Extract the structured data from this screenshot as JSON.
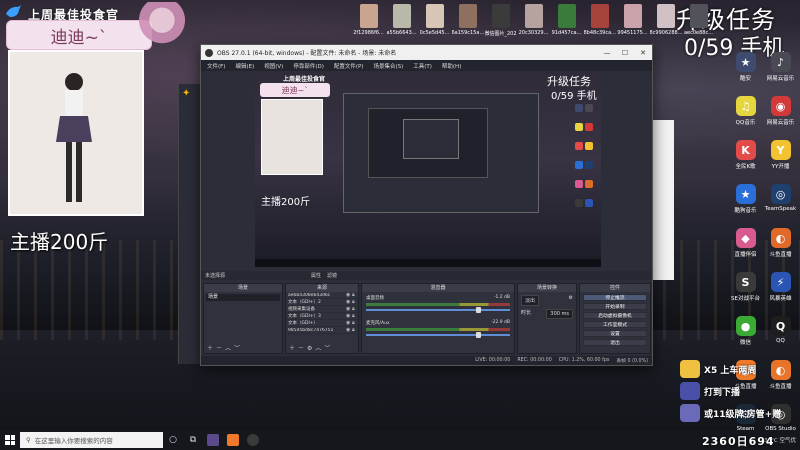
{
  "overlay": {
    "room_title": "上周最佳投食官",
    "streamer_name": "迪迪~`",
    "weight_text": "主播200斤",
    "upgrade_title": "升级任务",
    "upgrade_progress": "0/59 手机"
  },
  "desktop_icons_top": [
    {
      "label": "2f12986f6...",
      "color": "#c9a58f"
    },
    {
      "label": "a55b6643...",
      "color": "#b9b9a9"
    },
    {
      "label": "0c5e5d45...",
      "color": "#d7c6b6"
    },
    {
      "label": "6a159c15a...",
      "color": "#8f6f5e"
    },
    {
      "label": "微信图片_20210708...",
      "color": "#3b3b3b"
    },
    {
      "label": "20c30329...",
      "color": "#b6a39f"
    },
    {
      "label": "91d457ca...",
      "color": "#3a7a3a"
    },
    {
      "label": "8b48c39ca...",
      "color": "#a6433c"
    },
    {
      "label": "99451175...",
      "color": "#c9a3a9"
    },
    {
      "label": "8c9906288...",
      "color": "#d1c1c5"
    },
    {
      "label": "aec0e88c...",
      "color": "#52525b"
    }
  ],
  "desktop_icons_right": [
    {
      "label": "酷安",
      "glyph": "★",
      "color": "#3e4a6e"
    },
    {
      "label": "网易云音乐",
      "glyph": "♪",
      "color": "#4a4a55"
    },
    {
      "label": "QQ音乐",
      "glyph": "♫",
      "color": "#e5d640"
    },
    {
      "label": "网易云音乐",
      "glyph": "◉",
      "color": "#d23a3a"
    },
    {
      "label": "全民K歌",
      "glyph": "K",
      "color": "#e34b4b"
    },
    {
      "label": "YY开播",
      "glyph": "Y",
      "color": "#f2c230"
    },
    {
      "label": "酷狗音乐",
      "glyph": "★",
      "color": "#2a6ed8"
    },
    {
      "label": "TeamSpeak",
      "glyph": "◎",
      "color": "#1f3f6f"
    },
    {
      "label": "直播伴侣",
      "glyph": "◆",
      "color": "#d85a8f"
    },
    {
      "label": "斗鱼直播",
      "glyph": "◐",
      "color": "#e06a2a"
    },
    {
      "label": "SE对战平台",
      "glyph": "S",
      "color": "#3a3a3a"
    },
    {
      "label": "风暴英雄",
      "glyph": "⚡",
      "color": "#2a55b5"
    },
    {
      "label": "微信",
      "glyph": "●",
      "color": "#3aaa35"
    },
    {
      "label": "QQ",
      "glyph": "Q",
      "color": "#1e1e1e"
    },
    {
      "label": "斗鱼直播",
      "glyph": "◐",
      "color": "#f07a2a"
    },
    {
      "label": "斗鱼直播",
      "glyph": "◐",
      "color": "#e8742a"
    },
    {
      "label": "Steam",
      "glyph": "⚙",
      "color": "#1b2838"
    },
    {
      "label": "OBS Studio",
      "glyph": "◎",
      "color": "#303030"
    }
  ],
  "obs": {
    "title": "OBS 27.0.1 (64-bit, windows) - 配置文件: 未命名 - 场景: 未命名",
    "menu": [
      "文件(F)",
      "编辑(E)",
      "视图(V)",
      "停靠部件(D)",
      "配置文件(P)",
      "场景集合(S)",
      "工具(T)",
      "帮助(H)"
    ],
    "dock_top_left": "未选择源",
    "dock_top_props": "属性",
    "dock_top_filters": "滤镜",
    "scenes_header": "场景",
    "scenes": [
      "场景"
    ],
    "sources_header": "来源",
    "sources": [
      "ae6b4308e643d6c",
      "文本（GDI+）2",
      "视频采集设备",
      "文本（GDI+）3",
      "文本（GDI+）",
      "985d5bd8c7476751"
    ],
    "mixer_header": "混音器",
    "mixer_tracks": [
      {
        "name": "桌面音频",
        "db": "-1.2 dB"
      },
      {
        "name": "麦克风/Aux",
        "db": "-22.9 dB"
      }
    ],
    "transitions_header": "场景转换",
    "transition_type": "淡出",
    "duration_label": "时长",
    "duration_value": "300 ms",
    "controls_header": "控件",
    "controls": [
      "停止推流",
      "开始录制",
      "启动虚拟摄像机",
      "工作室模式",
      "设置",
      "退出"
    ],
    "status": {
      "live": "LIVE: 00:00:00",
      "rec": "REC: 00:00:00",
      "cpu": "CPU: 1.2%, 60.00 fps",
      "dropped": "丢帧 0 (0.0%)"
    }
  },
  "gifts": [
    {
      "text": "X5 上车两周",
      "color": "#f0c040"
    },
    {
      "text": "打到下播",
      "color": "#4a4fa8"
    },
    {
      "text": "或11级牌 房管+赠",
      "color": "#6a6ab8"
    }
  ],
  "taskbar": {
    "search_placeholder": "在这里输入你要搜索的内容",
    "weather": "30°C 空气优",
    "viewer_count": "2360日694"
  }
}
